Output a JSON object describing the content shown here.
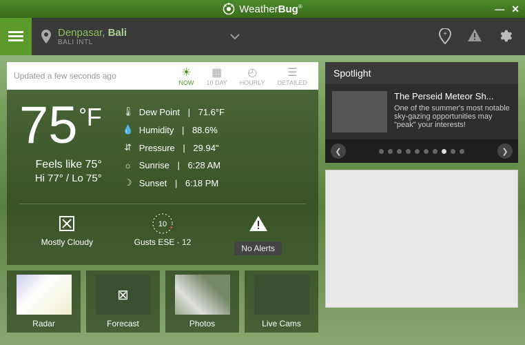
{
  "brand": {
    "name_a": "Weather",
    "name_b": "Bug",
    "reg": "®"
  },
  "location": {
    "city_a": "Denpasar,",
    "city_b": "Bali",
    "sub": "BALI INTL"
  },
  "updated": "Updated a few seconds ago",
  "tabs": {
    "now": "NOW",
    "tenday": "10 DAY",
    "hourly": "HOURLY",
    "detailed": "DETAILED"
  },
  "hero": {
    "temp": "75",
    "unit": "F",
    "feels": "Feels like 75°",
    "hilo": "Hi 77° / Lo 75°",
    "dew_label": "Dew Point",
    "dew_value": "71.6°F",
    "hum_label": "Humidity",
    "hum_value": "88.6%",
    "pres_label": "Pressure",
    "pres_value": "29.94\"",
    "rise_label": "Sunrise",
    "rise_value": "6:28 AM",
    "set_label": "Sunset",
    "set_value": "6:18 PM"
  },
  "mid": {
    "cond": "Mostly Cloudy",
    "wind_value": "10",
    "wind": "Gusts ESE · 12",
    "alerts": "No Alerts"
  },
  "thumbs": {
    "radar": "Radar",
    "forecast": "Forecast",
    "photos": "Photos",
    "livecams": "Live Cams"
  },
  "spotlight": {
    "heading": "Spotlight",
    "title": "The Perseid Meteor Sh...",
    "body": "One of the summer's most notable sky-gazing opportunities may \"peak\" your interests!",
    "active_dot": 7,
    "dot_count": 10
  }
}
